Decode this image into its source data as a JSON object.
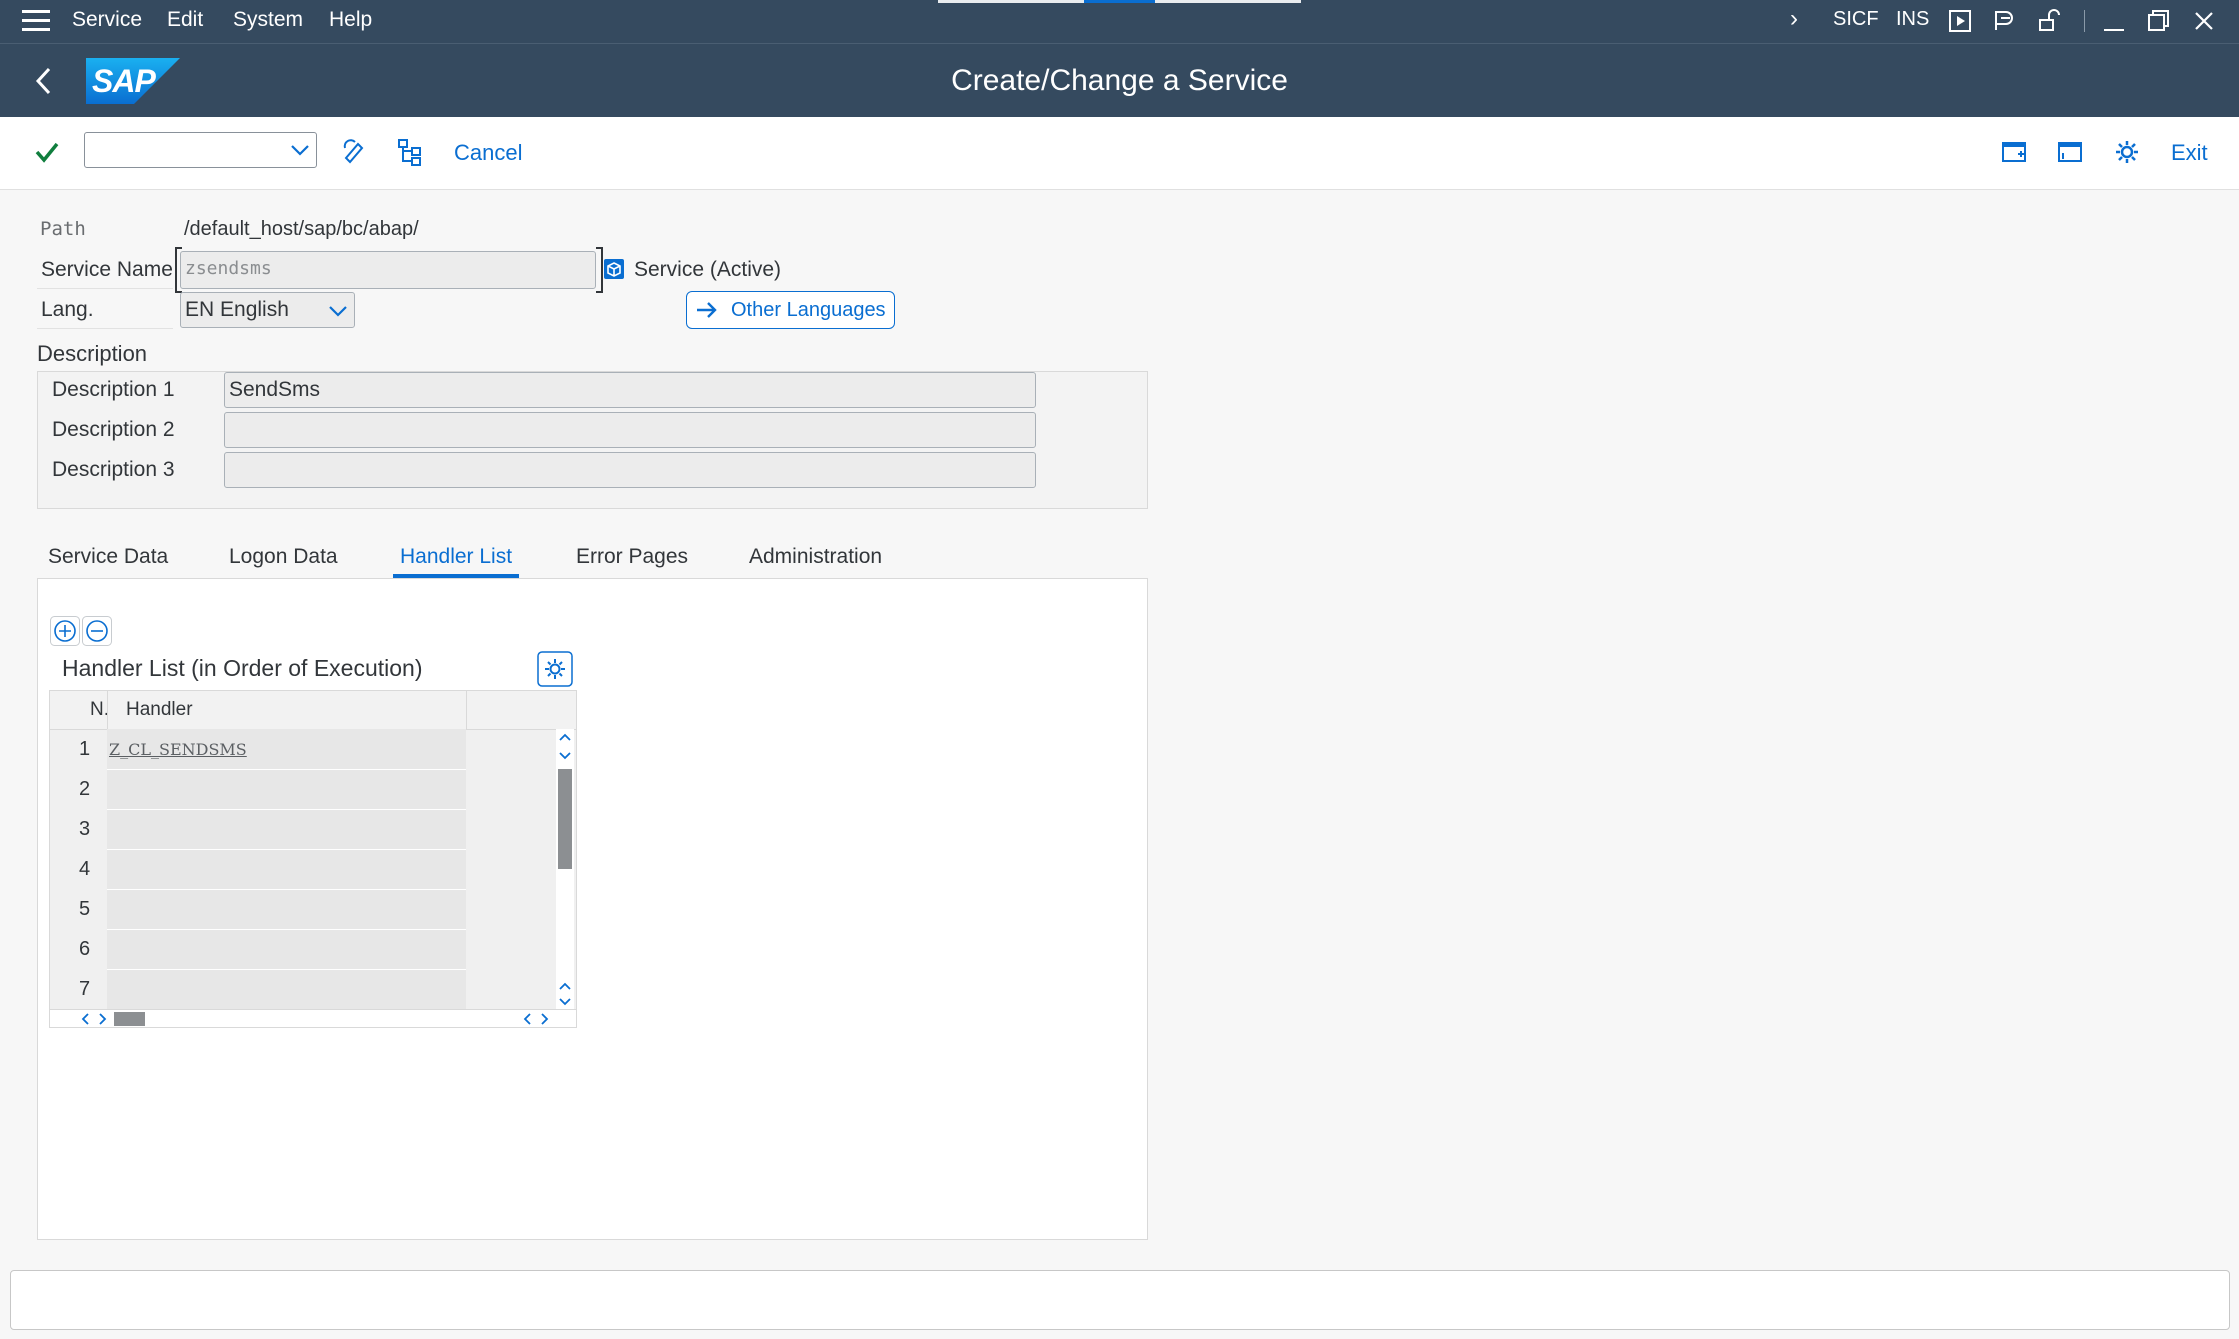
{
  "menubar": {
    "items": [
      "Service",
      "Edit",
      "System",
      "Help"
    ],
    "transaction": "SICF",
    "mode": "INS"
  },
  "titlebar": {
    "title": "Create/Change a Service",
    "logo_text": "SAP"
  },
  "toolbar": {
    "command_value": "",
    "cancel_label": "Cancel",
    "exit_label": "Exit"
  },
  "form": {
    "path_label": "Path",
    "path_value": "/default_host/sap/bc/abap/",
    "service_name_label": "Service Name",
    "service_name_value": "zsendsms",
    "service_status": "Service (Active)",
    "lang_label": "Lang.",
    "lang_value": "EN English",
    "other_languages_label": "Other Languages",
    "description_heading": "Description",
    "descriptions": [
      {
        "label": "Description 1",
        "value": "SendSms"
      },
      {
        "label": "Description 2",
        "value": ""
      },
      {
        "label": "Description 3",
        "value": ""
      }
    ]
  },
  "tabs": [
    "Service Data",
    "Logon Data",
    "Handler List",
    "Error Pages",
    "Administration"
  ],
  "active_tab": "Handler List",
  "handler_list": {
    "title": "Handler List (in Order of Execution)",
    "columns": [
      "N.",
      "Handler"
    ],
    "rows": [
      {
        "n": "1",
        "handler": "Z_CL_SENDSMS"
      },
      {
        "n": "2",
        "handler": ""
      },
      {
        "n": "3",
        "handler": ""
      },
      {
        "n": "4",
        "handler": ""
      },
      {
        "n": "5",
        "handler": ""
      },
      {
        "n": "6",
        "handler": ""
      },
      {
        "n": "7",
        "handler": ""
      }
    ]
  },
  "colors": {
    "shell": "#354a5f",
    "accent": "#0a6ed1",
    "ok_green": "#107e3e"
  }
}
